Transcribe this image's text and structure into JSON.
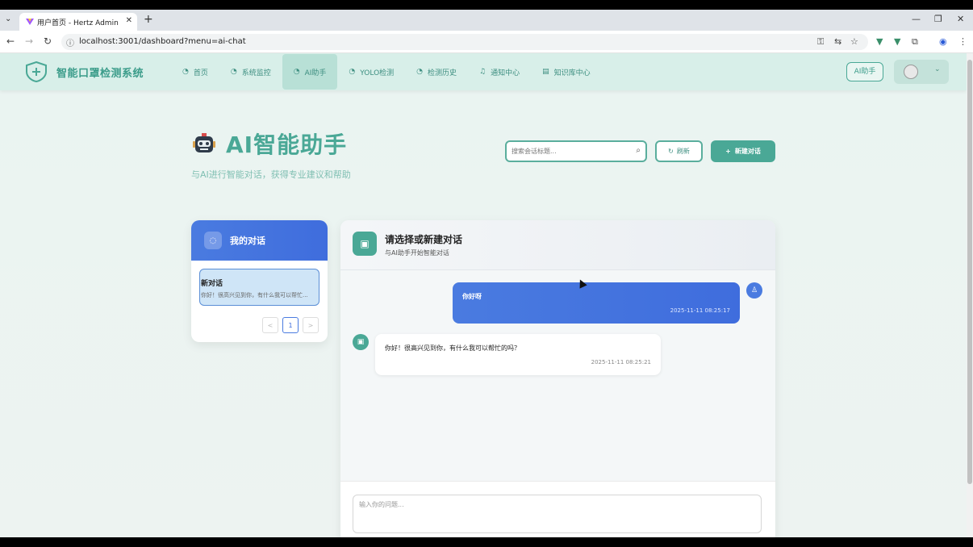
{
  "browser": {
    "tab_title": "用户首页 - Hertz Admin",
    "url": "localhost:3001/dashboard?menu=ai-chat",
    "new_tab": "+",
    "tab_close": "✕",
    "window_controls": [
      "—",
      "❐",
      "✕"
    ]
  },
  "navbar": {
    "brand": "智能口罩检测系统",
    "menu": [
      {
        "label": "首页",
        "icon": "dashboard-icon",
        "active": false
      },
      {
        "label": "系统监控",
        "icon": "dashboard-icon",
        "active": false
      },
      {
        "label": "AI助手",
        "icon": "dashboard-icon",
        "active": true
      },
      {
        "label": "YOLO检测",
        "icon": "dashboard-icon",
        "active": false
      },
      {
        "label": "检测历史",
        "icon": "dashboard-icon",
        "active": false
      },
      {
        "label": "通知中心",
        "icon": "bell-icon",
        "active": false
      },
      {
        "label": "知识库中心",
        "icon": "book-icon",
        "active": false
      }
    ],
    "ai_button": "AI助手"
  },
  "page": {
    "title": "AI智能助手",
    "subtitle": "与AI进行智能对话，获得专业建议和帮助",
    "search_placeholder": "搜索会话标题...",
    "refresh_label": "刷新",
    "new_chat_label": "新建对话"
  },
  "conversations": {
    "header": "我的对话",
    "items": [
      {
        "title": "新对话",
        "preview": "你好！很高兴见到你，有什么我可以帮忙..."
      }
    ],
    "pagination": {
      "prev": "<",
      "current": "1",
      "next": ">"
    }
  },
  "chat": {
    "title": "请选择或新建对话",
    "subtitle": "与AI助手开始智能对话",
    "messages": [
      {
        "role": "user",
        "text": "你好呀",
        "time": "2025-11-11 08:25:17"
      },
      {
        "role": "assistant",
        "text": "你好！很高兴见到你，有什么我可以帮忙的吗？",
        "time": "2025-11-11 08:25:21"
      }
    ],
    "input_placeholder": "输入你的问题..."
  },
  "colors": {
    "brand": "#4aa896",
    "accent_blue": "#3f6ddd",
    "navbar_bg": "#d8efe9"
  }
}
